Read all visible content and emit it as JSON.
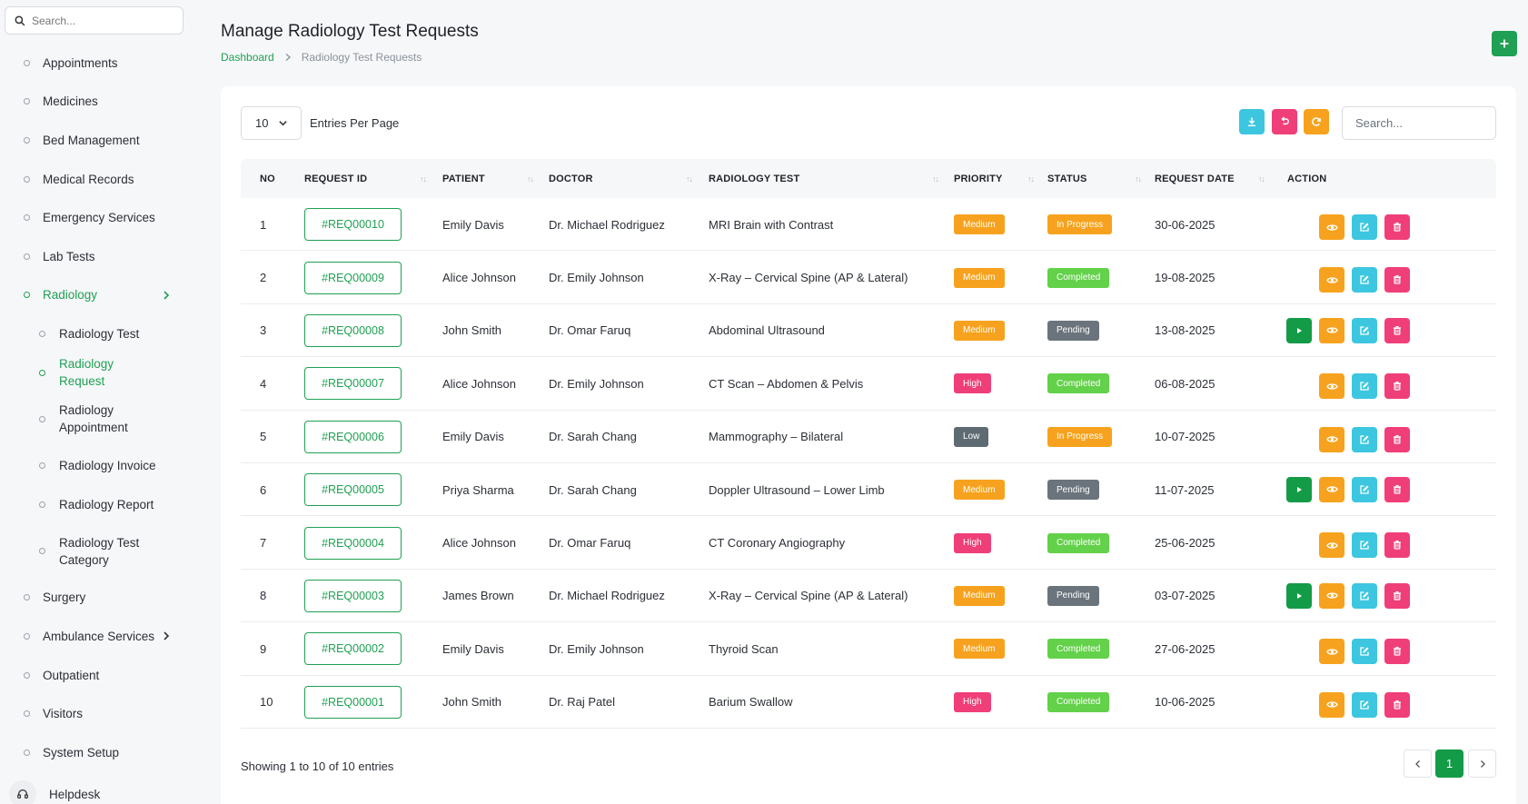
{
  "sidebar": {
    "search_placeholder": "Search...",
    "items": [
      {
        "label": "Appointments"
      },
      {
        "label": "Medicines"
      },
      {
        "label": "Bed Management"
      },
      {
        "label": "Medical Records"
      },
      {
        "label": "Emergency Services"
      },
      {
        "label": "Lab Tests"
      },
      {
        "label": "Radiology"
      },
      {
        "label": "Surgery"
      },
      {
        "label": "Ambulance Services"
      },
      {
        "label": "Outpatient"
      },
      {
        "label": "Visitors"
      },
      {
        "label": "System Setup"
      }
    ],
    "radiology_sub": [
      {
        "label": "Radiology Test"
      },
      {
        "label": "Radiology Request"
      },
      {
        "label": "Radiology Appointment"
      },
      {
        "label": "Radiology Invoice"
      },
      {
        "label": "Radiology Report"
      },
      {
        "label": "Radiology Test Category"
      }
    ],
    "helpdesk": "Helpdesk"
  },
  "header": {
    "title": "Manage Radiology Test Requests",
    "breadcrumb_home": "Dashboard",
    "breadcrumb_current": "Radiology Test Requests"
  },
  "controls": {
    "entries_value": "10",
    "entries_label": "Entries Per Page",
    "search_placeholder": "Search..."
  },
  "table": {
    "headers": [
      "NO",
      "REQUEST ID",
      "PATIENT",
      "DOCTOR",
      "RADIOLOGY TEST",
      "PRIORITY",
      "STATUS",
      "REQUEST DATE",
      "ACTION"
    ],
    "sort_glyph": "↑↓",
    "rows": [
      {
        "no": "1",
        "id": "#REQ00010",
        "patient": "Emily Davis",
        "doctor": "Dr. Michael Rodriguez",
        "test": "MRI Brain with Contrast",
        "priority": "Medium",
        "status": "In Progress",
        "date": "30-06-2025"
      },
      {
        "no": "2",
        "id": "#REQ00009",
        "patient": "Alice Johnson",
        "doctor": "Dr. Emily Johnson",
        "test": "X-Ray – Cervical Spine (AP & Lateral)",
        "priority": "Medium",
        "status": "Completed",
        "date": "19-08-2025"
      },
      {
        "no": "3",
        "id": "#REQ00008",
        "patient": "John Smith",
        "doctor": "Dr. Omar Faruq",
        "test": "Abdominal Ultrasound",
        "priority": "Medium",
        "status": "Pending",
        "date": "13-08-2025"
      },
      {
        "no": "4",
        "id": "#REQ00007",
        "patient": "Alice Johnson",
        "doctor": "Dr. Emily Johnson",
        "test": "CT Scan – Abdomen & Pelvis",
        "priority": "High",
        "status": "Completed",
        "date": "06-08-2025"
      },
      {
        "no": "5",
        "id": "#REQ00006",
        "patient": "Emily Davis",
        "doctor": "Dr. Sarah Chang",
        "test": "Mammography – Bilateral",
        "priority": "Low",
        "status": "In Progress",
        "date": "10-07-2025"
      },
      {
        "no": "6",
        "id": "#REQ00005",
        "patient": "Priya Sharma",
        "doctor": "Dr. Sarah Chang",
        "test": "Doppler Ultrasound – Lower Limb",
        "priority": "Medium",
        "status": "Pending",
        "date": "11-07-2025"
      },
      {
        "no": "7",
        "id": "#REQ00004",
        "patient": "Alice Johnson",
        "doctor": "Dr. Omar Faruq",
        "test": "CT Coronary Angiography",
        "priority": "High",
        "status": "Completed",
        "date": "25-06-2025"
      },
      {
        "no": "8",
        "id": "#REQ00003",
        "patient": "James Brown",
        "doctor": "Dr. Michael Rodriguez",
        "test": "X-Ray – Cervical Spine (AP & Lateral)",
        "priority": "Medium",
        "status": "Pending",
        "date": "03-07-2025"
      },
      {
        "no": "9",
        "id": "#REQ00002",
        "patient": "Emily Davis",
        "doctor": "Dr. Emily Johnson",
        "test": "Thyroid Scan",
        "priority": "Medium",
        "status": "Completed",
        "date": "27-06-2025"
      },
      {
        "no": "10",
        "id": "#REQ00001",
        "patient": "John Smith",
        "doctor": "Dr. Raj Patel",
        "test": "Barium Swallow",
        "priority": "High",
        "status": "Completed",
        "date": "10-06-2025"
      }
    ]
  },
  "footer": {
    "showing": "Showing 1 to 10 of 10 entries",
    "page": "1"
  },
  "colors": {
    "accent": "#1fa053",
    "priority": {
      "Medium": "#f7a21e",
      "High": "#f03f78",
      "Low": "#5f6b73"
    },
    "status": {
      "In Progress": "#f7a21e",
      "Completed": "#63d14a",
      "Pending": "#6b747c"
    }
  },
  "icons": {
    "search": "search-icon",
    "add": "plus-icon",
    "download": "download-icon",
    "undo": "undo-icon",
    "refresh": "refresh-icon",
    "play": "play-icon",
    "view": "eye-icon",
    "edit": "edit-icon",
    "delete": "trash-icon",
    "helpdesk": "headset-icon"
  }
}
